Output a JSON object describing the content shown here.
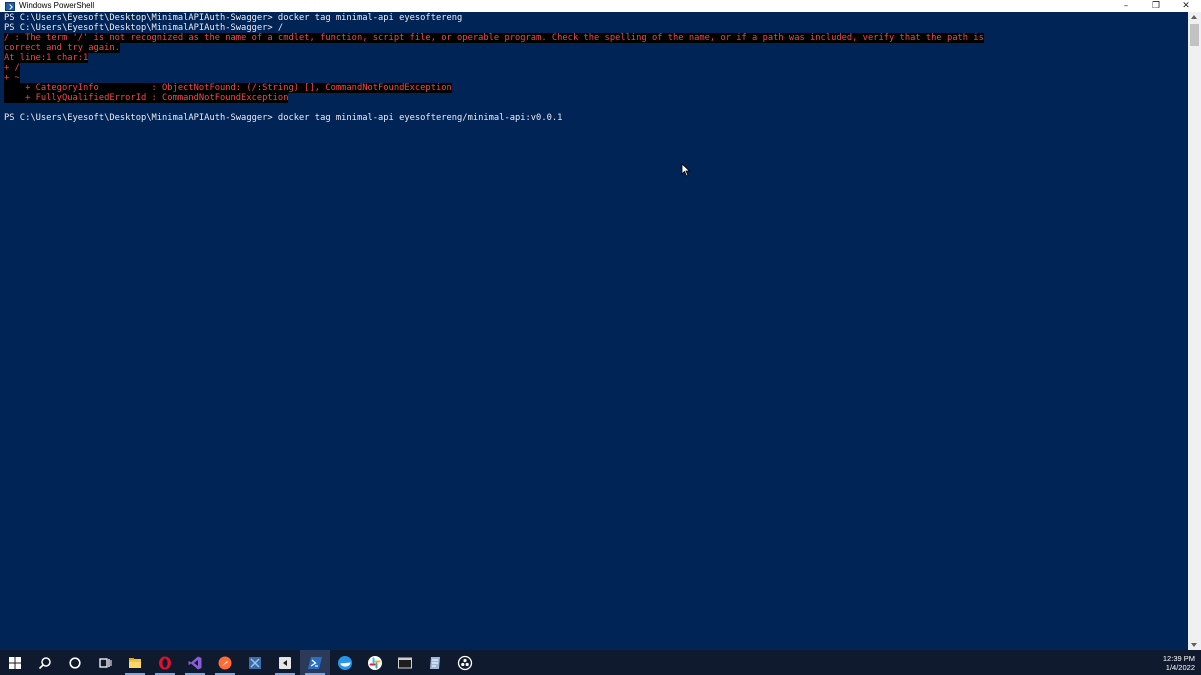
{
  "window": {
    "title": "Windows PowerShell",
    "controls": {
      "minimize": "–",
      "restore": "❐",
      "close": "✕"
    }
  },
  "console": {
    "lines": [
      {
        "type": "cmd",
        "text": "PS C:\\Users\\Eyesoft\\Desktop\\MinimalAPIAuth-Swagger> docker tag minimal-api eyesoftereng"
      },
      {
        "type": "cmd",
        "text": "PS C:\\Users\\Eyesoft\\Desktop\\MinimalAPIAuth-Swagger> /"
      },
      {
        "type": "err",
        "text": "/ : The term '/' is not recognized as the name of a cmdlet, function, script file, or operable program. Check the spelling of the name, or if a path was included, verify that the path is"
      },
      {
        "type": "err",
        "text": "correct and try again."
      },
      {
        "type": "err",
        "text": "At line:1 char:1"
      },
      {
        "type": "err",
        "text": "+ /"
      },
      {
        "type": "err",
        "text": "+ ~"
      },
      {
        "type": "err",
        "text": "    + CategoryInfo          : ObjectNotFound: (/:String) [], CommandNotFoundException"
      },
      {
        "type": "err",
        "text": "    + FullyQualifiedErrorId : CommandNotFoundException"
      },
      {
        "type": "blank",
        "text": " "
      },
      {
        "type": "cmd",
        "text": "PS C:\\Users\\Eyesoft\\Desktop\\MinimalAPIAuth-Swagger> docker tag minimal-api eyesoftereng/minimal-api:v0.0.1"
      }
    ]
  },
  "taskbar": {
    "items": [
      {
        "name": "start-icon",
        "running": false,
        "active": false
      },
      {
        "name": "search-icon",
        "running": false,
        "active": false
      },
      {
        "name": "cortana-icon",
        "running": false,
        "active": false
      },
      {
        "name": "task-view-icon",
        "running": false,
        "active": false
      },
      {
        "name": "file-explorer-icon",
        "running": true,
        "active": false
      },
      {
        "name": "opera-icon",
        "running": true,
        "active": false
      },
      {
        "name": "visual-studio-icon",
        "running": true,
        "active": false
      },
      {
        "name": "postman-icon",
        "running": true,
        "active": false
      },
      {
        "name": "remote-desktop-icon",
        "running": false,
        "active": false
      },
      {
        "name": "camtasia-icon",
        "running": true,
        "active": false
      },
      {
        "name": "powershell-icon",
        "running": true,
        "active": true
      },
      {
        "name": "docker-icon",
        "running": false,
        "active": false
      },
      {
        "name": "slack-icon",
        "running": false,
        "active": false
      },
      {
        "name": "terminal-icon",
        "running": false,
        "active": false
      },
      {
        "name": "notes-icon",
        "running": false,
        "active": false
      },
      {
        "name": "obs-icon",
        "running": false,
        "active": false
      }
    ],
    "clock": {
      "time": "12:39 PM",
      "date": "1/4/2022"
    }
  },
  "colors": {
    "console_bg": "#012456",
    "console_fg": "#eeedf0",
    "error_fg": "#f44747",
    "error_bg": "#000000",
    "taskbar_bg": "#101a2e"
  }
}
